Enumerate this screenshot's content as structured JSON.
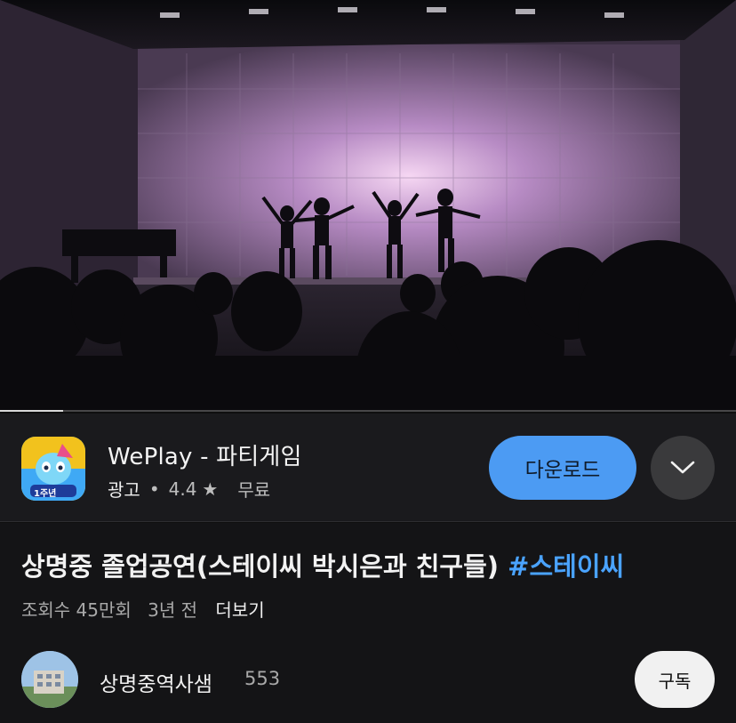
{
  "video": {
    "progress_fraction": 0.086
  },
  "ad": {
    "app_name": "WePlay - 파티게임",
    "badge_text": "1주년",
    "ad_label": "광고",
    "separator": "•",
    "rating": "4.4",
    "star": "★",
    "price": "무료",
    "download_label": "다운로드",
    "icons": {
      "expand": "chevron-down-icon",
      "app": "weplay-app-icon",
      "rating": "star-icon"
    }
  },
  "info": {
    "title": "상명중 졸업공연(스테이씨 박시은과 친구들)",
    "hashtag": "#스테이씨",
    "views": "조회수 45만회",
    "age": "3년 전",
    "more": "더보기"
  },
  "channel": {
    "name": "상명중역사샘",
    "subscribers": "553",
    "subscribe_label": "구독"
  },
  "colors": {
    "background": "#0f0f0f",
    "accent_blue": "#4c9bf3",
    "hashtag": "#4aa3ff"
  }
}
